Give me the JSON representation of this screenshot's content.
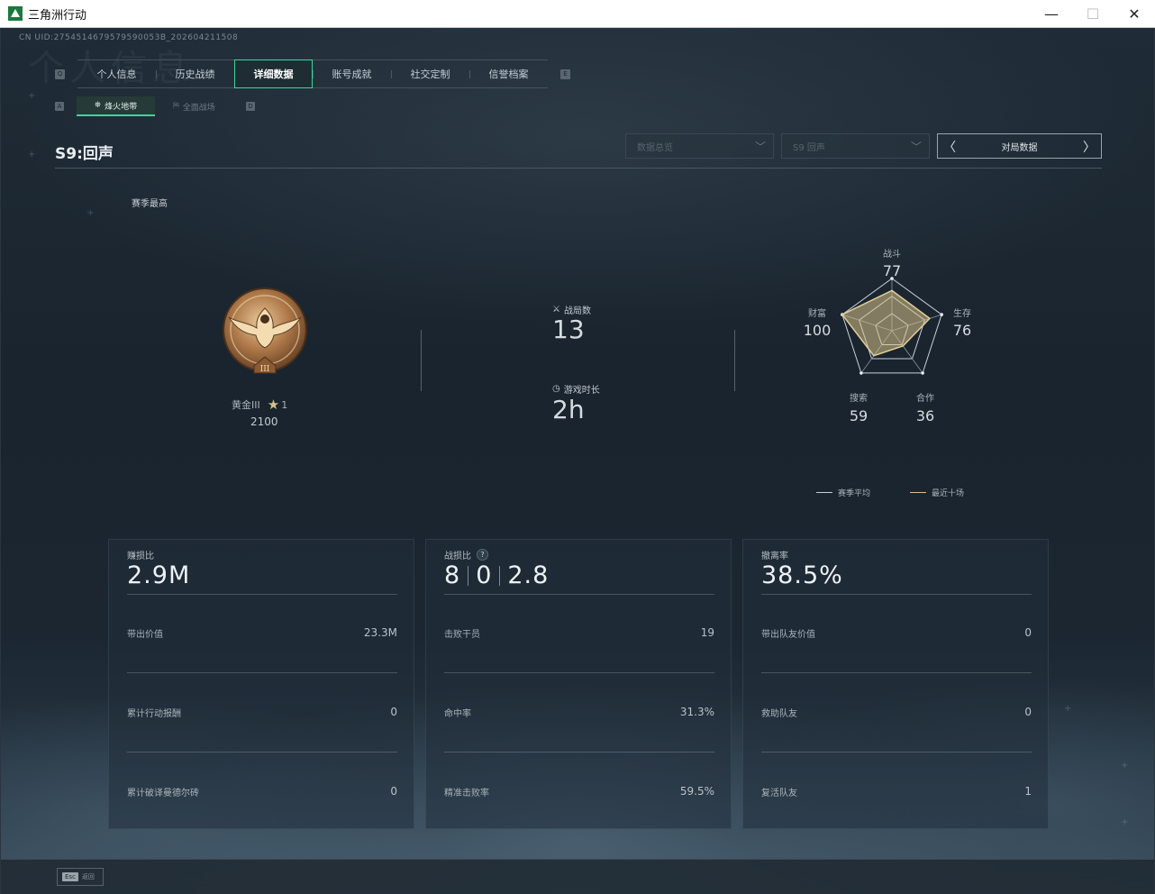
{
  "window": {
    "title": "三角洲行动",
    "minimize": "—",
    "maximize": "☐",
    "close": "✕"
  },
  "uid": "CN UID:2754514679579590053B_202604211508",
  "ghost_text": "个人信息",
  "tabs": {
    "left_key": "Q",
    "right_key": "E",
    "items": [
      {
        "label": "个人信息"
      },
      {
        "label": "历史战绩"
      },
      {
        "label": "详细数据"
      },
      {
        "label": "账号成就"
      },
      {
        "label": "社交定制"
      },
      {
        "label": "信誉档案"
      }
    ],
    "active_index": 2
  },
  "subtabs": {
    "left_key": "A",
    "right_key": "D",
    "items": [
      {
        "label": "烽火地带",
        "icon": "⛯"
      },
      {
        "label": "全面战场",
        "icon": "⛿"
      }
    ]
  },
  "season_title": "S9:回声",
  "filters": {
    "dropdown1": "数据总览",
    "dropdown2": "S9 回声",
    "pager_label": "对局数据",
    "prev": "〈",
    "next": "〉"
  },
  "season_best_label": "赛季最高",
  "rank": {
    "name": "黄金III",
    "stars": "1",
    "score": "2100",
    "medal_numeral": "III"
  },
  "games": {
    "label": "战局数",
    "value": "13"
  },
  "playtime": {
    "label": "游戏时长",
    "value": "2h"
  },
  "radar": {
    "labels": {
      "combat": "战斗",
      "survival": "生存",
      "teamwork": "合作",
      "search": "搜索",
      "wealth": "财富"
    },
    "values": {
      "combat": "77",
      "survival": "76",
      "teamwork": "36",
      "search": "59",
      "wealth": "100"
    },
    "recent_ratio": {
      "combat": 0.77,
      "survival": 0.76,
      "teamwork": 0.36,
      "search": 0.59,
      "wealth": 1.0
    },
    "fill_color": "#d9c28a"
  },
  "legend": {
    "season_avg": "赛季平均",
    "recent10": "最近十场",
    "season_color": "#c8d0d5",
    "recent_color": "#d9c28a"
  },
  "cards": [
    {
      "label": "赚损比",
      "big": "2.9M",
      "rows": [
        {
          "k": "带出价值",
          "v": "23.3M"
        },
        {
          "k": "累计行动报酬",
          "v": "0"
        },
        {
          "k": "累计破译曼德尔砖",
          "v": "0"
        }
      ]
    },
    {
      "label": "战损比",
      "qmark": "?",
      "kd": [
        "8",
        "0",
        "2.8"
      ],
      "rows": [
        {
          "k": "击败干员",
          "v": "19"
        },
        {
          "k": "命中率",
          "v": "31.3%"
        },
        {
          "k": "精准击败率",
          "v": "59.5%"
        }
      ]
    },
    {
      "label": "撤离率",
      "big": "38.5%",
      "rows": [
        {
          "k": "带出队友价值",
          "v": "0"
        },
        {
          "k": "救助队友",
          "v": "0"
        },
        {
          "k": "复活队友",
          "v": "1"
        }
      ]
    }
  ],
  "footer": {
    "esc_key": "Esc",
    "esc_label": "返回"
  }
}
